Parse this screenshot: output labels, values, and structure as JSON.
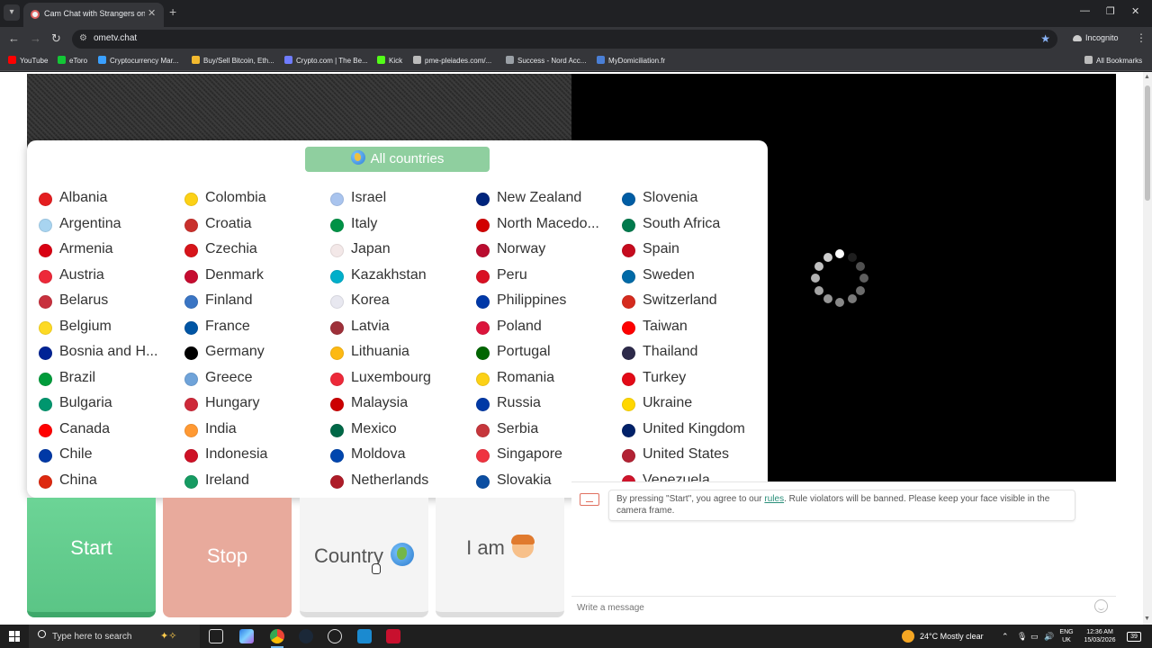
{
  "browser": {
    "tab_title": "Cam Chat with Strangers on Ome",
    "url": "ometv.chat",
    "profile_label": "Incognito",
    "bookmarks": [
      {
        "label": "YouTube",
        "color": "#ff0000"
      },
      {
        "label": "eToro",
        "color": "#13c636"
      },
      {
        "label": "Cryptocurrency Mar...",
        "color": "#3aa0ff"
      },
      {
        "label": "Buy/Sell Bitcoin, Eth...",
        "color": "#f3ba2f"
      },
      {
        "label": "Crypto.com | The Be...",
        "color": "#6f7cff"
      },
      {
        "label": "Kick",
        "color": "#53fc18"
      },
      {
        "label": "pme-pleiades.com/...",
        "color": "#bbbbbb"
      },
      {
        "label": "Success - Nord Acc...",
        "color": "#9aa0a6"
      },
      {
        "label": "MyDomiciliation.fr",
        "color": "#4a7fd6"
      }
    ],
    "all_bookmarks_label": "All Bookmarks"
  },
  "popup": {
    "all_countries_label": "All countries",
    "columns": [
      [
        {
          "name": "Albania",
          "flag": "#e41e20"
        },
        {
          "name": "Argentina",
          "flag": "#a8d4f0"
        },
        {
          "name": "Armenia",
          "flag": "#d90012"
        },
        {
          "name": "Austria",
          "flag": "#ed2939"
        },
        {
          "name": "Belarus",
          "flag": "#c8313e"
        },
        {
          "name": "Belgium",
          "flag": "#fdda24"
        },
        {
          "name": "Bosnia and H...",
          "flag": "#002395"
        },
        {
          "name": "Brazil",
          "flag": "#009c3b"
        },
        {
          "name": "Bulgaria",
          "flag": "#00966e"
        },
        {
          "name": "Canada",
          "flag": "#ff0000"
        },
        {
          "name": "Chile",
          "flag": "#0039a6"
        },
        {
          "name": "China",
          "flag": "#de2910"
        }
      ],
      [
        {
          "name": "Colombia",
          "flag": "#fcd116"
        },
        {
          "name": "Croatia",
          "flag": "#c9302c"
        },
        {
          "name": "Czechia",
          "flag": "#d7141a"
        },
        {
          "name": "Denmark",
          "flag": "#c60c30"
        },
        {
          "name": "Finland",
          "flag": "#3a75c4"
        },
        {
          "name": "France",
          "flag": "#0055a4"
        },
        {
          "name": "Germany",
          "flag": "#000000"
        },
        {
          "name": "Greece",
          "flag": "#6fa3d9"
        },
        {
          "name": "Hungary",
          "flag": "#ce2939"
        },
        {
          "name": "India",
          "flag": "#ff9933"
        },
        {
          "name": "Indonesia",
          "flag": "#ce1126"
        },
        {
          "name": "Ireland",
          "flag": "#169b62"
        }
      ],
      [
        {
          "name": "Israel",
          "flag": "#a9c4ee"
        },
        {
          "name": "Italy",
          "flag": "#009246"
        },
        {
          "name": "Japan",
          "flag": "#f3e8e8"
        },
        {
          "name": "Kazakhstan",
          "flag": "#00afca"
        },
        {
          "name": "Korea",
          "flag": "#e8e8f0"
        },
        {
          "name": "Latvia",
          "flag": "#9e3039"
        },
        {
          "name": "Lithuania",
          "flag": "#fdb913"
        },
        {
          "name": "Luxembourg",
          "flag": "#ed2939"
        },
        {
          "name": "Malaysia",
          "flag": "#cc0001"
        },
        {
          "name": "Mexico",
          "flag": "#006847"
        },
        {
          "name": "Moldova",
          "flag": "#0046ae"
        },
        {
          "name": "Netherlands",
          "flag": "#ae1c28"
        }
      ],
      [
        {
          "name": "New Zealand",
          "flag": "#00247d"
        },
        {
          "name": "North Macedo...",
          "flag": "#d20000"
        },
        {
          "name": "Norway",
          "flag": "#ba0c2f"
        },
        {
          "name": "Peru",
          "flag": "#d91023"
        },
        {
          "name": "Philippines",
          "flag": "#0038a8"
        },
        {
          "name": "Poland",
          "flag": "#dc143c"
        },
        {
          "name": "Portugal",
          "flag": "#006600"
        },
        {
          "name": "Romania",
          "flag": "#fcd116"
        },
        {
          "name": "Russia",
          "flag": "#0039a6"
        },
        {
          "name": "Serbia",
          "flag": "#c6363c"
        },
        {
          "name": "Singapore",
          "flag": "#ef3340"
        },
        {
          "name": "Slovakia",
          "flag": "#0b4ea2"
        }
      ],
      [
        {
          "name": "Slovenia",
          "flag": "#005da4"
        },
        {
          "name": "South Africa",
          "flag": "#007a4d"
        },
        {
          "name": "Spain",
          "flag": "#c60b1e"
        },
        {
          "name": "Sweden",
          "flag": "#006aa7"
        },
        {
          "name": "Switzerland",
          "flag": "#d52b1e"
        },
        {
          "name": "Taiwan",
          "flag": "#fe0000"
        },
        {
          "name": "Thailand",
          "flag": "#2d2a4a"
        },
        {
          "name": "Turkey",
          "flag": "#e30a17"
        },
        {
          "name": "Ukraine",
          "flag": "#ffd700"
        },
        {
          "name": "United Kingdom",
          "flag": "#012169"
        },
        {
          "name": "United States",
          "flag": "#b22234"
        },
        {
          "name": "Venezuela",
          "flag": "#cf142b"
        }
      ]
    ]
  },
  "controls": {
    "start_label": "Start",
    "stop_label": "Stop",
    "country_label": "Country",
    "iam_label": "I am"
  },
  "chat": {
    "system_message_before": "By pressing \"Start\", you agree to our ",
    "rules_link": "rules",
    "system_message_after": ". Rule violators will be banned. Please keep your face visible in the camera frame.",
    "input_placeholder": "Write a message"
  },
  "taskbar": {
    "search_placeholder": "Type here to search",
    "weather": "24°C  Mostly clear",
    "lang_top": "ENG",
    "lang_bottom": "UK",
    "time": "12:36 AM",
    "date": "15/03/2026",
    "notification_count": "39"
  },
  "colors": {
    "start": "#5bc586",
    "stop": "#e8aa9c",
    "all_countries": "#8fcf9f",
    "link": "#2a8f7a"
  }
}
